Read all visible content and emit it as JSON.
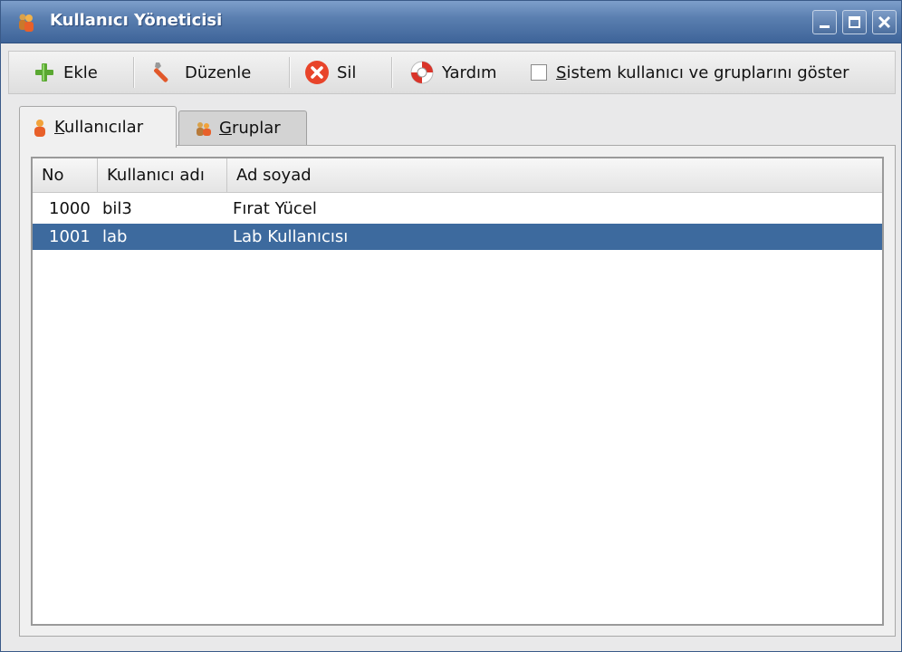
{
  "window": {
    "title": "Kullanıcı Yöneticisi",
    "controls": [
      "minimize",
      "maximize",
      "close"
    ]
  },
  "toolbar": {
    "add_label": "Ekle",
    "edit_label": "Düzenle",
    "delete_label": "Sil",
    "help_label": "Yardım",
    "show_system_label": "Sistem kullanıcı ve gruplarını göster",
    "show_system_checked": false
  },
  "tabs": {
    "users": {
      "label": "Kullanıcılar",
      "active": true
    },
    "groups": {
      "label": "Gruplar",
      "active": false
    }
  },
  "table": {
    "columns": [
      "No",
      "Kullanıcı adı",
      "Ad soyad"
    ],
    "rows": [
      {
        "no": "1000",
        "username": "bil3",
        "fullname": "Fırat Yücel",
        "selected": false
      },
      {
        "no": "1001",
        "username": "lab",
        "fullname": "Lab Kullanıcısı",
        "selected": true
      }
    ]
  },
  "colors": {
    "titlebar": "#4f74a8",
    "selection": "#3d6a9e",
    "delete_icon": "#e8442a",
    "add_icon": "#5aa832"
  }
}
